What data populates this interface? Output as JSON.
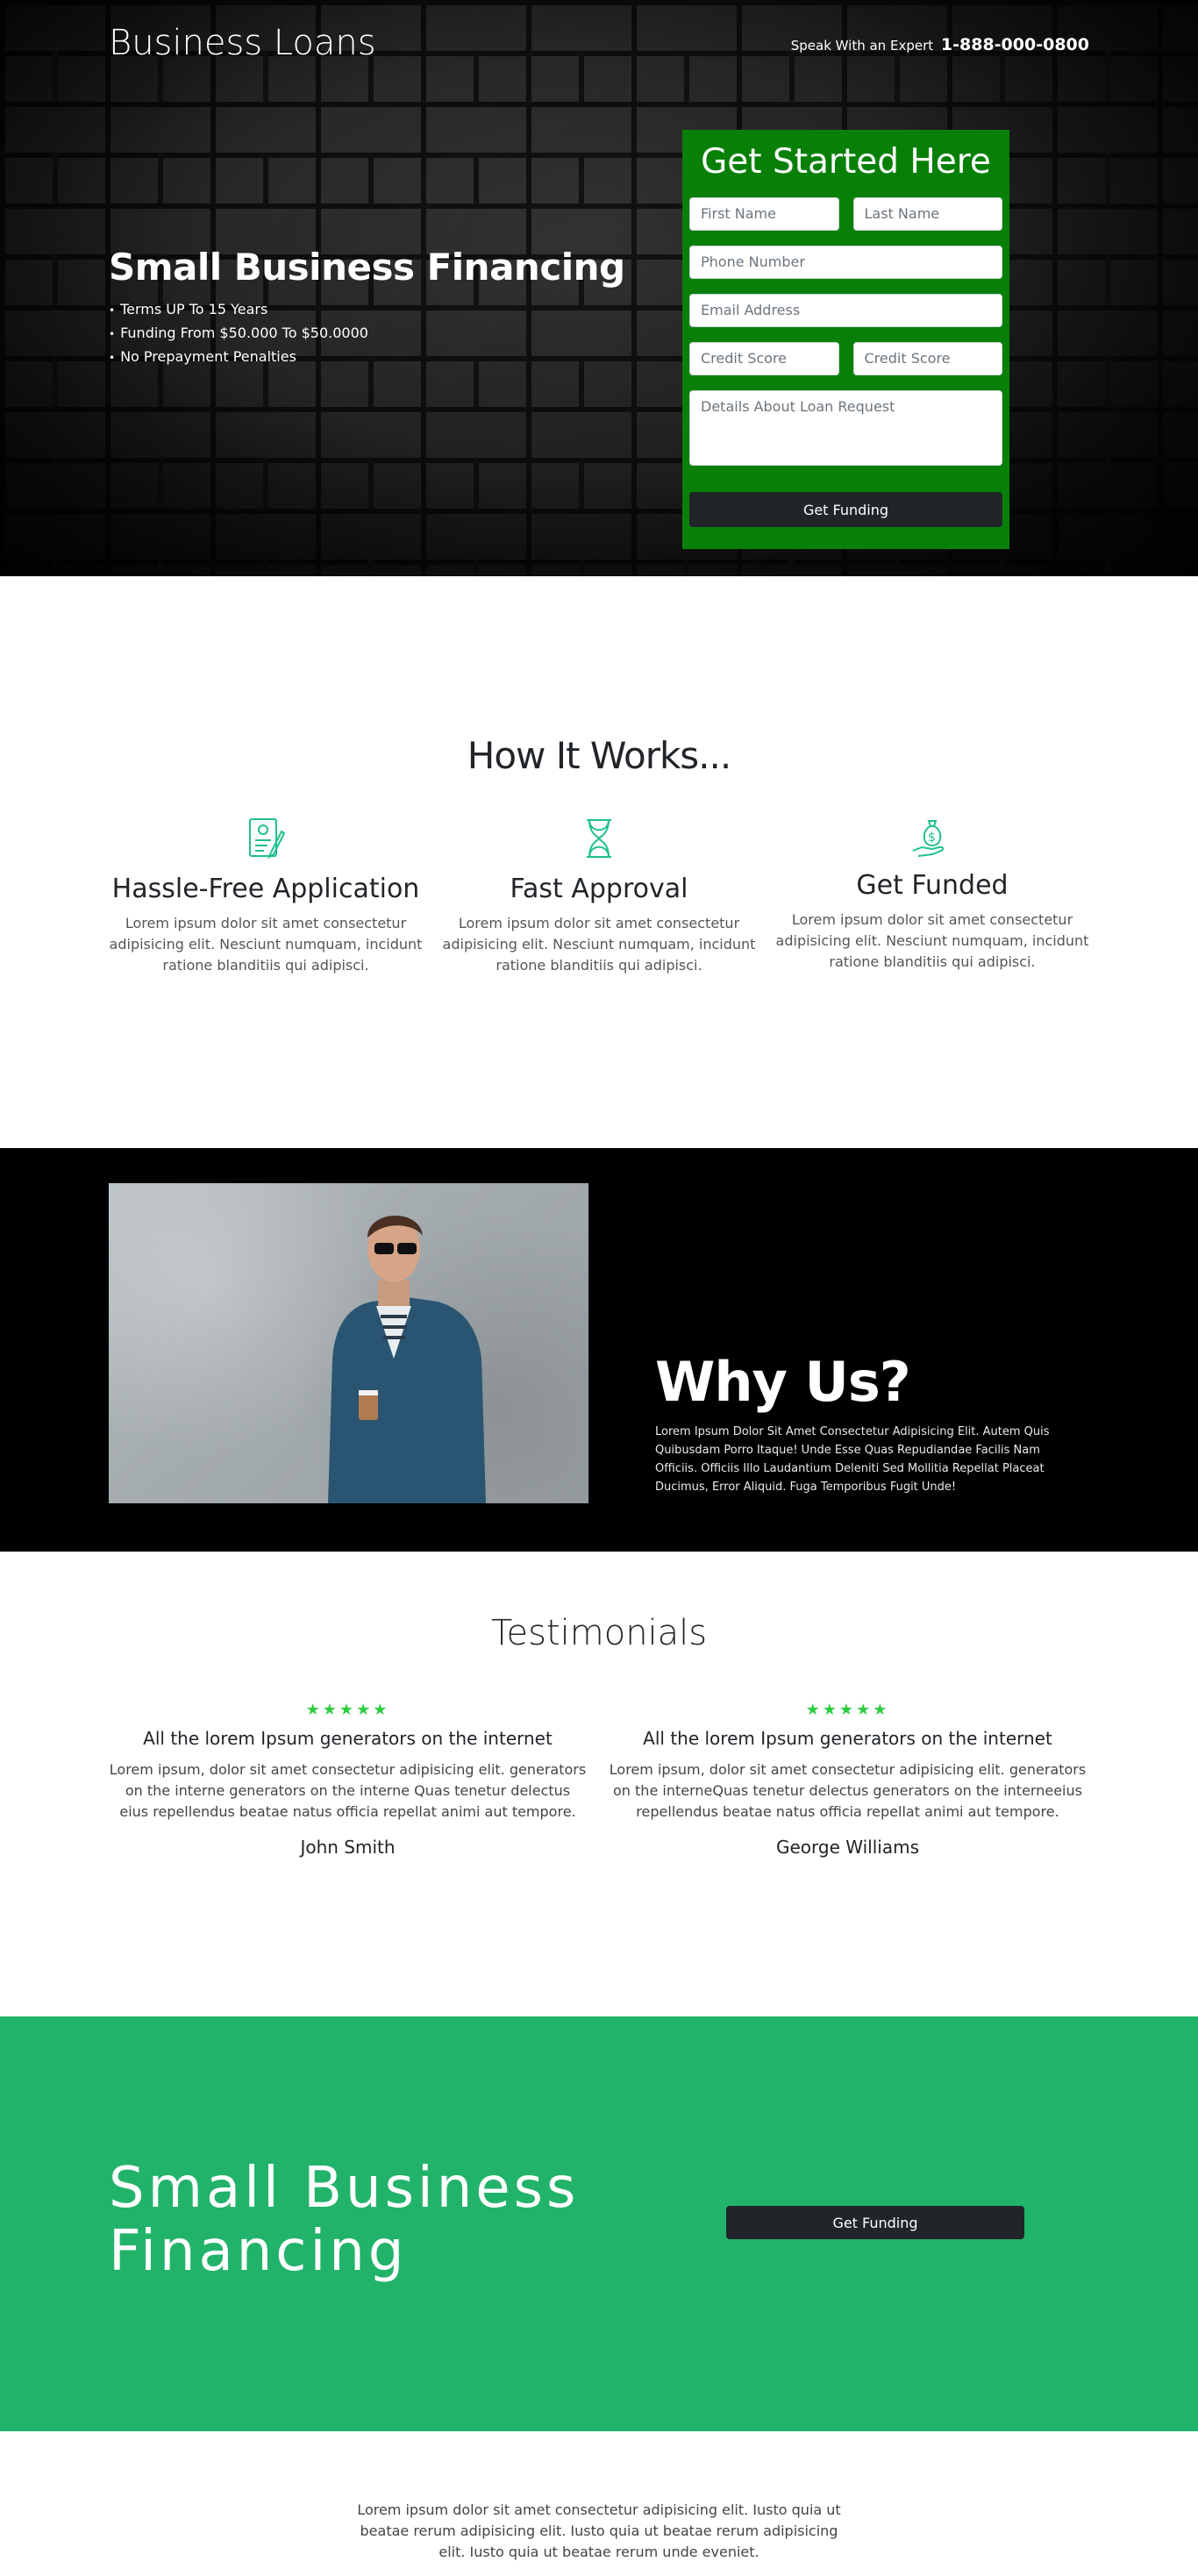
{
  "header": {
    "brand": "Business Loans",
    "phone_prefix": "Speak With an Expert",
    "phone": "1-888-000-0800"
  },
  "hero": {
    "title": "Small Business Financing",
    "bullets": [
      "Terms UP To 15 Years",
      "Funding From $50.000 To $50.0000",
      "No Prepayment Penalties"
    ]
  },
  "form": {
    "title": "Get Started Here",
    "first_name": "First Name",
    "last_name": "Last Name",
    "phone": "Phone Number",
    "email": "Email Address",
    "credit_1": "Credit Score",
    "credit_2": "Credit Score",
    "details": "Details About Loan Request",
    "submit": "Get Funding"
  },
  "how": {
    "title": "How It Works...",
    "steps": [
      {
        "title": "Hassle-Free Application",
        "text": "Lorem ipsum dolor sit amet consectetur adipisicing elit. Nesciunt numquam, incidunt ratione blanditiis qui adipisci.",
        "icon": "application-form-icon"
      },
      {
        "title": "Fast Approval",
        "text": "Lorem ipsum dolor sit amet consectetur adipisicing elit. Nesciunt numquam, incidunt ratione blanditiis qui adipisci.",
        "icon": "hourglass-icon"
      },
      {
        "title": "Get Funded",
        "text": "Lorem ipsum dolor sit amet consectetur adipisicing elit. Nesciunt numquam, incidunt ratione blanditiis qui adipisci.",
        "icon": "money-bag-hand-icon"
      }
    ]
  },
  "why": {
    "title": "Why Us?",
    "text": "Lorem Ipsum Dolor Sit Amet Consectetur Adipisicing Elit. Autem Quis Quibusdam Porro Itaque! Unde Esse Quas Repudiandae Facilis Nam Officiis. Officiis Illo Laudantium Deleniti Sed Mollitia Repellat Placeat Ducimus, Error Aliquid. Fuga Temporibus Fugit Unde!"
  },
  "testimonials": {
    "title": "Testimonials",
    "stars": "★★★★★",
    "items": [
      {
        "heading": "All the lorem Ipsum generators on the internet",
        "text": "Lorem ipsum, dolor sit amet consectetur adipisicing elit. generators on the interne generators on the interne Quas tenetur delectus eius repellendus beatae natus officia repellat animi aut tempore.",
        "author": "John Smith"
      },
      {
        "heading": "All the lorem Ipsum generators on the internet",
        "text": "Lorem ipsum, dolor sit amet consectetur adipisicing elit. generators on the interneQuas tenetur delectus generators on the interneeius repellendus beatae natus officia repellat animi aut tempore.",
        "author": "George Williams"
      }
    ]
  },
  "cta": {
    "title": "Small Business Financing",
    "button": "Get Funding"
  },
  "footer": {
    "text": "Lorem ipsum dolor sit amet consectetur adipisicing elit. Iusto quia ut beatae rerum adipisicing elit. Iusto quia ut beatae rerum adipisicing elit. Iusto quia ut beatae rerum unde eveniet."
  },
  "colors": {
    "form_green": "#088008",
    "cta_green": "#22b36a",
    "icon_teal": "#1fbf8f",
    "star_green": "#2ecc40",
    "dark_button": "#212529"
  }
}
